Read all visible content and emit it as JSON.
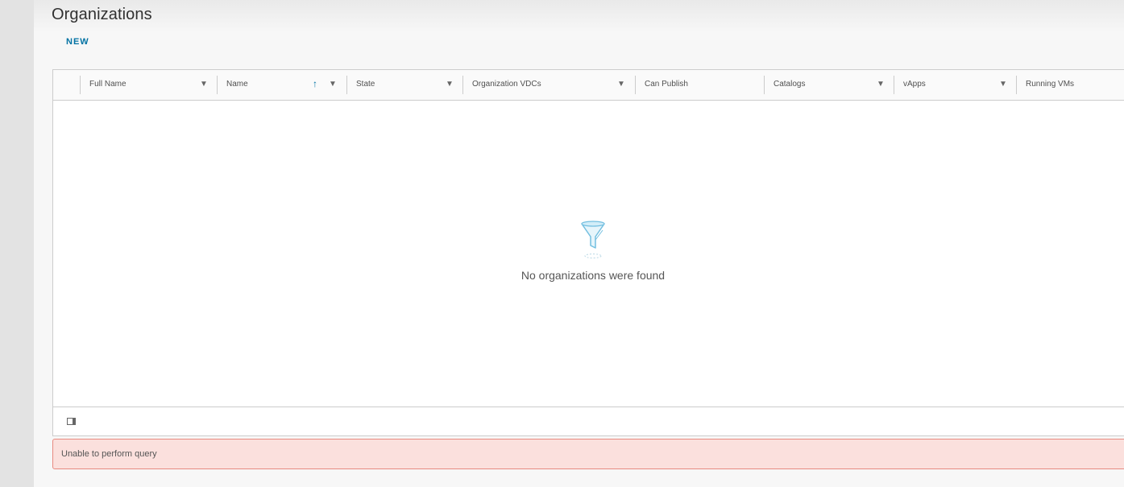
{
  "page": {
    "title": "Organizations"
  },
  "toolbar": {
    "new_label": "NEW"
  },
  "grid": {
    "columns": [
      {
        "label": "Full Name",
        "filter_icon": "filter-icon"
      },
      {
        "label": "Name",
        "sort_icon": "sort-ascending-icon",
        "filter_icon": "filter-icon"
      },
      {
        "label": "State",
        "filter_icon": "filter-icon"
      },
      {
        "label": "Organization VDCs",
        "filter_icon": "filter-icon"
      },
      {
        "label": "Can Publish"
      },
      {
        "label": "Catalogs",
        "filter_icon": "filter-icon"
      },
      {
        "label": "vApps",
        "filter_icon": "filter-icon"
      },
      {
        "label": "Running VMs"
      }
    ],
    "empty_message": "No organizations were found",
    "empty_icon": "empty-filter-icon"
  },
  "footer": {
    "column_toggle_icon": "column-toggle-icon"
  },
  "alert": {
    "message": "Unable to perform query",
    "color": "#fbe0dd",
    "border_color": "#e88a80"
  },
  "colors": {
    "accent": "#0072a3"
  }
}
